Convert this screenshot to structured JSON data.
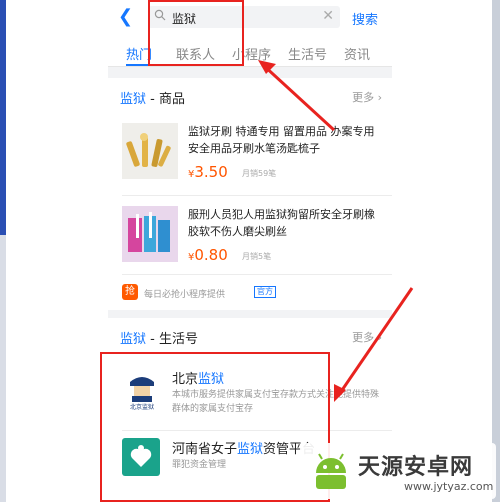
{
  "search": {
    "query": "监狱"
  },
  "labels": {
    "search_btn": "搜索"
  },
  "tabs": [
    "热门",
    "联系人",
    "小程序",
    "生活号",
    "资讯"
  ],
  "products_card": {
    "head_keyword": "监狱",
    "head_suffix": " - 商品",
    "more": "更多",
    "items": [
      {
        "title": "监狱牙刷 特通专用 留置用品 办案专用 安全用品牙刷水笔汤匙梳子",
        "yen": "¥",
        "price": "3.50",
        "sales": "月销59笔"
      },
      {
        "title": "服刑人员犯人用监狱狗留所安全牙刷橡胶软不伤人磨尖刷丝",
        "yen": "¥",
        "price": "0.80",
        "sales": "月销5笔"
      }
    ],
    "provider": {
      "badge": "抢",
      "text": "每日必抢小程序提供",
      "tag": "官方"
    }
  },
  "life_card": {
    "head_keyword": "监狱",
    "head_suffix": " - 生活号",
    "more": "更多",
    "accounts": [
      {
        "name_prefix": "北京",
        "name_keyword": "监狱",
        "name_suffix": "",
        "desc": "本城市服务提供家属支付宝存款方式关注能提供特殊群体的家属支付宝存",
        "logo_text": "北京监狱"
      },
      {
        "name_prefix": "河南省女子",
        "name_keyword": "监狱",
        "name_suffix": "资管平台",
        "desc": "罪犯资金管理"
      }
    ]
  },
  "watermark": {
    "text": "天源安卓网",
    "url": "www.jytyaz.com"
  },
  "colors": {
    "accent": "#1677ff",
    "price": "#ff5500",
    "annotation": "#e8231f"
  }
}
